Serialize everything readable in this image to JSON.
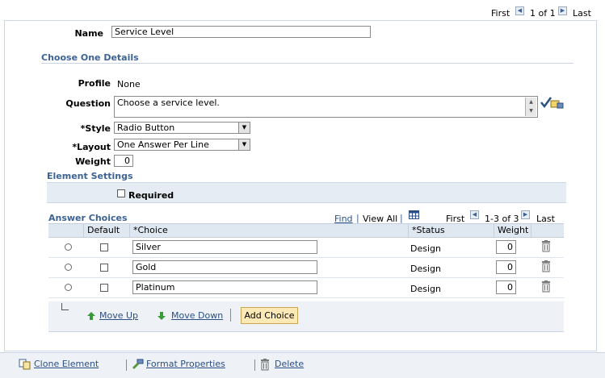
{
  "pager_top": {
    "first": "First",
    "range": "1 of 1",
    "last": "Last"
  },
  "name_label": "Name",
  "name_value": "Service Level",
  "section_title": "Choose One Details",
  "profile_label": "Profile",
  "profile_value": "None",
  "question_label": "Question",
  "question_value": "Choose a service level.",
  "style_label": "*Style",
  "style_value": "Radio Button",
  "layout_label": "*Layout",
  "layout_value": "One Answer Per Line",
  "weight_label": "Weight",
  "weight_value": "0",
  "element_settings_title": "Element Settings",
  "required_label": "Required",
  "answer_choices": {
    "title": "Answer Choices",
    "find": "Find",
    "view_all": "View All",
    "first": "First",
    "range": "1-3 of 3",
    "last": "Last",
    "columns": {
      "default": "Default",
      "choice": "*Choice",
      "status": "*Status",
      "weight": "Weight"
    },
    "rows": [
      {
        "choice": "Silver",
        "status": "Design",
        "weight": "0"
      },
      {
        "choice": "Gold",
        "status": "Design",
        "weight": "0"
      },
      {
        "choice": "Platinum",
        "status": "Design",
        "weight": "0"
      }
    ],
    "move_up": "Move Up",
    "move_down": "Move Down",
    "add_choice": "Add Choice"
  },
  "footer": {
    "clone": "Clone Element",
    "format": "Format Properties",
    "delete": "Delete"
  },
  "colors": {
    "accent": "#3c6394",
    "link": "#2b4f84",
    "button": "#fce9b6"
  }
}
